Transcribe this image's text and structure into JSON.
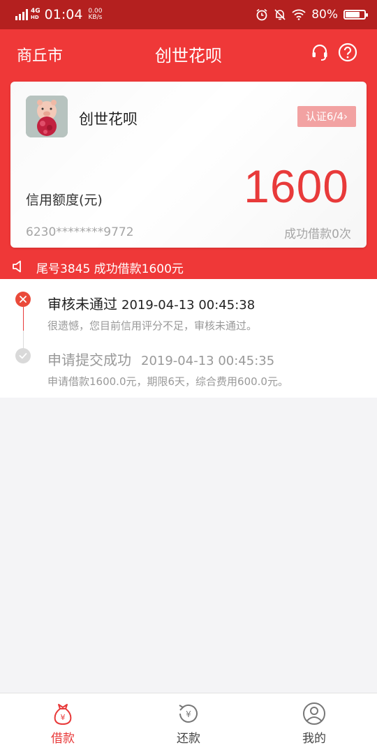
{
  "status_bar": {
    "network": "4G",
    "network_sub": "HD",
    "time": "01:04",
    "speed_value": "0.00",
    "speed_unit": "KB/s",
    "battery": "80%",
    "battery_level": 0.8
  },
  "header": {
    "city": "商丘市",
    "title": "创世花呗",
    "icons": [
      "headset-icon",
      "help-icon"
    ]
  },
  "card": {
    "name": "创世花呗",
    "cert_label": "认证6/4",
    "credit_label": "信用额度(元)",
    "credit_value": "1600",
    "card_number": "6230********9772",
    "loan_count": "成功借款0次"
  },
  "notice": {
    "icon": "speaker-icon",
    "text": "尾号3845 成功借款1600元"
  },
  "timeline": [
    {
      "status": "rejected",
      "title": "审核未通过",
      "time": "2019-04-13 00:45:38",
      "desc": "很遗憾，您目前信用评分不足，审核未通过。"
    },
    {
      "status": "done",
      "title": "申请提交成功",
      "time": "2019-04-13 00:45:35",
      "desc": "申请借款1600.0元，期限6天，综合费用600.0元。"
    }
  ],
  "bottom_nav": [
    {
      "label": "借款",
      "icon": "loan-bag-icon",
      "active": true
    },
    {
      "label": "还款",
      "icon": "repay-icon",
      "active": false
    },
    {
      "label": "我的",
      "icon": "profile-icon",
      "active": false
    }
  ],
  "colors": {
    "brand_red": "#ef3838",
    "status_bar": "#b4201f",
    "credit_value": "#e83a3a",
    "cert_button": "#f2a2a2",
    "muted_text": "#a5a5a5"
  }
}
